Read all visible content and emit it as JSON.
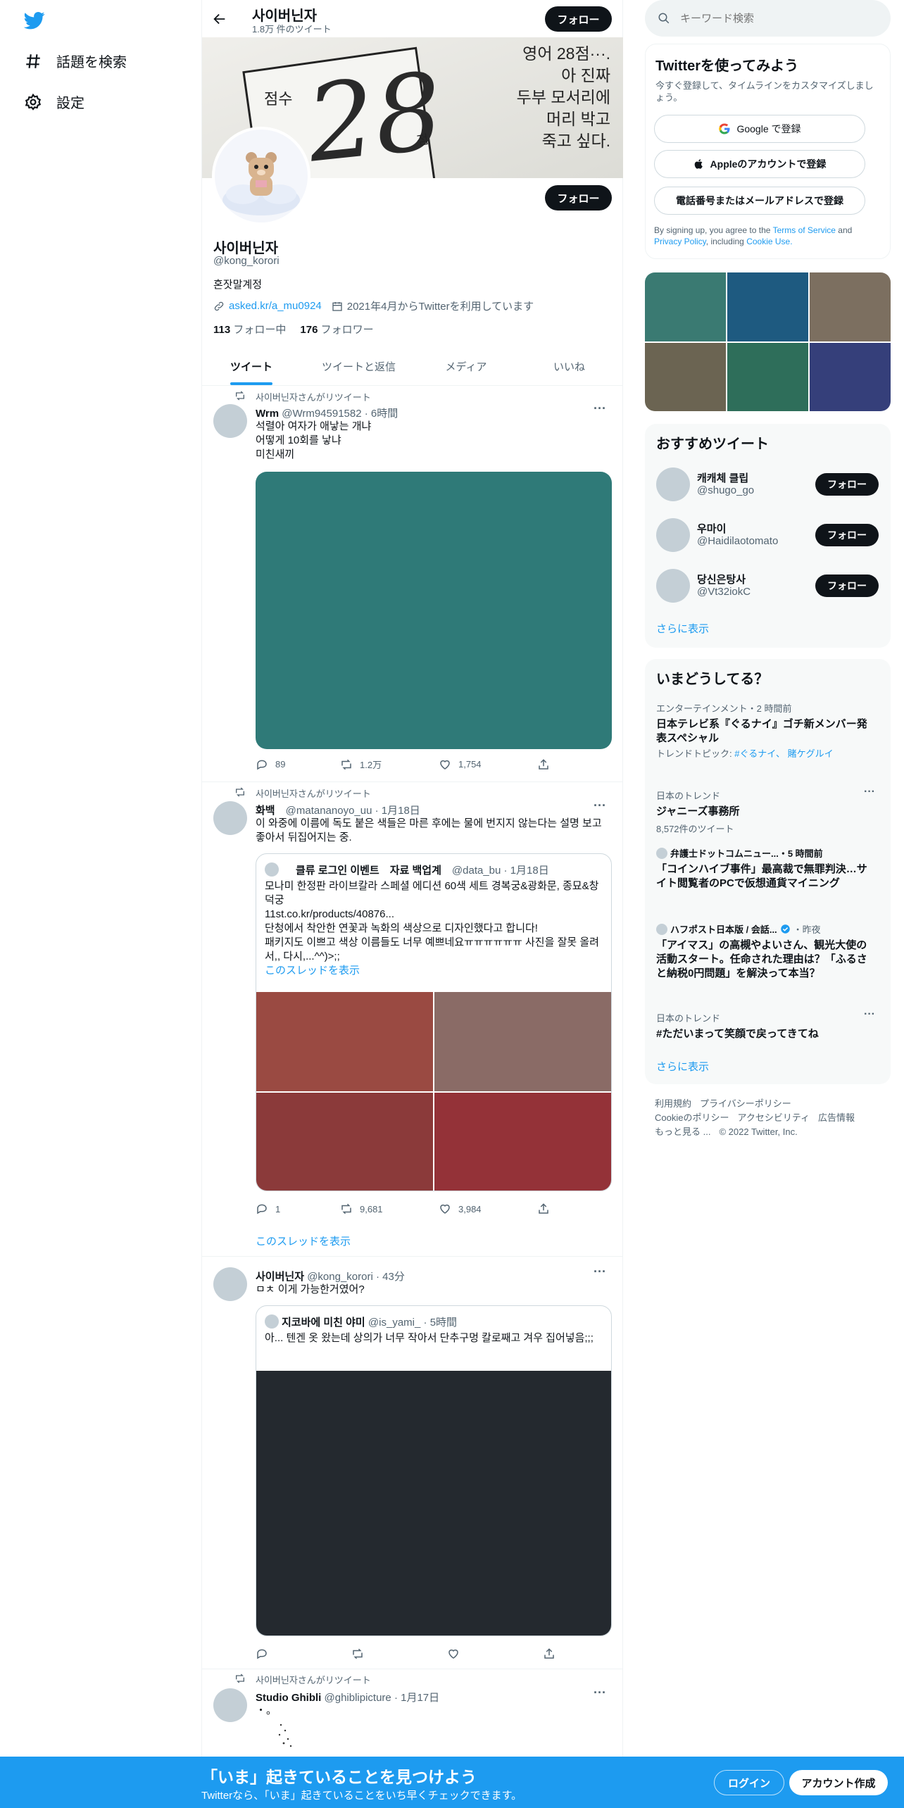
{
  "nav": {
    "explore": "話題を検索",
    "settings": "設定"
  },
  "profile": {
    "name": "사이버닌자",
    "tweet_count": "1.8万 件のツイート",
    "follow": "フォロー",
    "banner_text": [
      "영어 28점···.",
      "아 진짜",
      "두부 모서리에",
      "머리 박고",
      "죽고 싶다."
    ],
    "banner_score_label": "점수",
    "banner_score": "28",
    "banner_score_unit": "점",
    "handle": "@kong_korori",
    "bio": "혼잣말계정",
    "link": "asked.kr/a_mu0924",
    "joined": "2021年4月からTwitterを利用しています",
    "following_count": "113",
    "following_label": "フォロー中",
    "followers_count": "176",
    "followers_label": "フォロワー"
  },
  "tabs": [
    "ツイート",
    "ツイートと返信",
    "メディア",
    "いいね"
  ],
  "tweets": [
    {
      "context": "사이버닌자さんがリツイート",
      "name": "Wrm",
      "handle": "@Wrm94591582",
      "time": "6時間",
      "text": [
        "석렬아 여자가 애낳는 개냐",
        "어떻게 10회를 낳냐",
        "미친새끼"
      ],
      "image_color": "#2f7a78",
      "replies": "89",
      "retweets": "1.2万",
      "likes": "1,754"
    },
    {
      "context": "사이버닌자さんがリツイート",
      "name": "화백",
      "handle": "@matananoyo_uu",
      "time": "1月18日",
      "text": "이 와중에 이름에 독도 붙은 색들은 마른 후에는 물에 번지지 않는다는 설명 보고 좋아서 뒤집어지는 중.",
      "quote": {
        "name": "클류 로그인 이벤트　자료 백업계",
        "handle": "@data_bu",
        "time": "1月18日",
        "text": [
          "모나미 한정판 라이브칼라 스페셜 에디션 60색 세트 경복궁&광화문, 종묘&창덕궁",
          "11st.co.kr/products/40876...",
          "단청에서 착안한 연꽃과 녹화의 색상으로 디자인했다고 합니다!",
          "패키지도 이쁘고 색상 이름들도 너무 예쁘네요ㅠㅠㅠㅠㅠㅠ 사진을 잘못 올려서,, 다시,...^^)>;;"
        ],
        "show_thread": "このスレッドを表示",
        "colors": [
          "#9a4a42",
          "#8a6b66",
          "#8b3a3a",
          "#943238"
        ]
      },
      "replies": "1",
      "retweets": "9,681",
      "likes": "3,984",
      "show_thread": "このスレッドを表示"
    },
    {
      "name": "사이버닌자",
      "handle": "@kong_korori",
      "time": "43分",
      "text": "ㅁㅊ 이게 가능한거였어?",
      "quote": {
        "name": "지코바에 미친 야미",
        "handle": "@is_yami_",
        "time": "5時間",
        "text": "아... 텐겐 옷 왔는데 상의가 너무 작아서 단추구멍 칼로째고 겨우 집어넣음;;;",
        "image_color": "#24292f"
      }
    },
    {
      "context": "사이버닌자さんがリツイート",
      "name": "Studio Ghibli",
      "handle": "@ghiblipicture",
      "time": "1月17日",
      "text": "・。"
    }
  ],
  "search": {
    "placeholder": "キーワード検索"
  },
  "signup": {
    "title": "Twitterを使ってみよう",
    "subtitle": "今すぐ登録して、タイムラインをカスタマイズしましょう。",
    "google": "Google で登録",
    "apple": "Appleのアカウントで登録",
    "phone": "電話番号またはメールアドレスで登録",
    "terms_prefix": "By signing up, you agree to the",
    "terms": "Terms of Service",
    "and": "and",
    "privacy": "Privacy Policy",
    "including": ", including",
    "cookie": "Cookie Use."
  },
  "media_colors": [
    "#3a7a72",
    "#1e5a80",
    "#7c6f60",
    "#6b6452",
    "#2e6e5a",
    "#353f7a"
  ],
  "recommend": {
    "title": "おすすめツイート",
    "follow": "フォロー",
    "show_more": "さらに表示",
    "users": [
      {
        "name": "캐캐체 클립",
        "handle": "@shugo_go"
      },
      {
        "name": "우마이",
        "handle": "@Haidilaotomato"
      },
      {
        "name": "당신은탕사",
        "handle": "@Vt32iokC"
      }
    ]
  },
  "trends": {
    "title": "いまどうしてる？",
    "show_more": "さらに表示",
    "items": [
      {
        "meta": "エンターテインメント・2 時間前",
        "name": "日本テレビ系『ぐるナイ』ゴチ新メンバー発表スペシャル",
        "extra_prefix": "トレンドトピック:",
        "extra_links": "#ぐるナイ、 賭ケグルイ"
      },
      {
        "meta": "日本のトレンド",
        "name": "ジャニーズ事務所",
        "extra": "8,572件のツイート"
      },
      {
        "meta": "弁護士ドットコムニュー...・5 時間前",
        "name": "「コインハイブ事件」最高裁で無罪判決…サイト閲覧者のPCで仮想通貨マイニング"
      },
      {
        "meta": "ハフポスト日本版 / 会話...",
        "meta2": "・昨夜",
        "name": "「アイマス」の高槻やよいさん、観光大使の活動スタート。任命された理由は？「ふるさと納税0円問題」を解決って本当？"
      },
      {
        "meta": "日本のトレンド",
        "name": "#ただいまって笑顔で戻ってきてね"
      }
    ]
  },
  "footer": {
    "line1": [
      "利用規約",
      "プライバシーポリシー"
    ],
    "line2": [
      "Cookieのポリシー",
      "アクセシビリティ",
      "広告情報"
    ],
    "more": "もっと見る ...",
    "copyright": "© 2022 Twitter, Inc."
  },
  "bottom": {
    "title": "「いま」起きていることを見つけよう",
    "subtitle": "Twitterなら、「いま」起きていることをいち早くチェックできます。",
    "login": "ログイン",
    "signup": "アカウント作成"
  }
}
